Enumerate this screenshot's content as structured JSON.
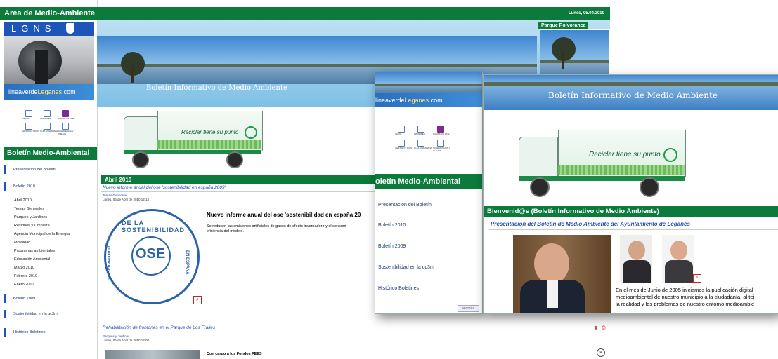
{
  "window_main": {
    "area_title": "Area de Medio-Ambiente",
    "lgns": "LGNS",
    "lineaverde": {
      "part1": "lineaverde",
      "part2": "Leganes",
      "part3": ".com"
    },
    "icons": [
      {
        "icon": "home-icon",
        "label": "INICIO"
      },
      {
        "icon": "sitemap-icon",
        "label": "MAPA WEB"
      },
      {
        "icon": "24h-icon",
        "label": "HORAS ON LINE"
      },
      {
        "icon": "gestion-icon",
        "label": "GESTION Y DIAS"
      },
      {
        "icon": "guia-icon",
        "label": "GUIA CIUDADANA"
      },
      {
        "icon": "sugerencias-icon",
        "label": "SUGERENCIAS Y QUEJAS"
      }
    ],
    "boletin_heading": "Boletín Medio-Ambiental",
    "nav": [
      {
        "label": "Presentación del Boletín",
        "type": "major"
      },
      {
        "label": "Boletín 2010",
        "type": "major"
      },
      {
        "label": "Abril 2010",
        "type": "sub"
      },
      {
        "label": "Temas Generales",
        "type": "sub"
      },
      {
        "label": "Parques y Jardines",
        "type": "sub"
      },
      {
        "label": "Residuos y Limpieza",
        "type": "sub"
      },
      {
        "label": "Agencia Municipal de la Energía",
        "type": "sub"
      },
      {
        "label": "Movilidad",
        "type": "sub"
      },
      {
        "label": "Programas ambientales",
        "type": "sub"
      },
      {
        "label": "Educación Ambiental",
        "type": "sub"
      },
      {
        "label": "Marzo 2010",
        "type": "sub"
      },
      {
        "label": "Febrero 2010",
        "type": "sub"
      },
      {
        "label": "Enero 2010",
        "type": "sub"
      },
      {
        "label": "Boletín 2009",
        "type": "major"
      },
      {
        "label": "Sostenibilidad en la uc3m",
        "type": "major"
      },
      {
        "label": "Histórico Boletines",
        "type": "major"
      }
    ],
    "date": "Lunes, 05.04.2010",
    "parque_label": "Parque Polvoranca",
    "banner_title": "Boletín Informativo de Medio Ambiente",
    "truck_slogan": "Reciclar tiene su punto",
    "section_title": "Abril 2010",
    "article1": {
      "link_title": "Nuevo informe anual del ose 'sostenibilidad en españa 2009'",
      "category": "Temas Generales",
      "date": "Lunes, 05 de Abril de 2010 12:14",
      "headline": "Nuevo informe anual del ose 'sostenibilidad en españa 20",
      "body": "Se reducen las emisiones artificiales de gases de efecto invernadero y el consum",
      "body2": "eficiencia del modelo.",
      "seal_top": "DE LA SOSTENIBILIDAD",
      "seal_left": "OBSERVATORIO",
      "seal_right": "EN ESPAÑA",
      "seal_center": "OSE"
    },
    "article2": {
      "link_title": "Rehabilitación de frontones en el Parque de Los Frailes",
      "category": "Parques y Jardines",
      "date": "Lunes, 05 de Abril de 2010 12:08",
      "headline": "Con cargo a los Fondos FEES"
    }
  },
  "window_middle": {
    "lineaverde": {
      "part1": "lineaverde",
      "part2": "Leganes",
      "part3": ".com"
    },
    "icons": [
      {
        "icon": "home-icon",
        "label": "INICIO"
      },
      {
        "icon": "sitemap-icon",
        "label": "MAPA WEB"
      },
      {
        "icon": "24h-icon",
        "label": "HORAS ON LINE"
      },
      {
        "icon": "gestion-icon",
        "label": "GESTION Y DIAS"
      },
      {
        "icon": "guia-icon",
        "label": "GUIA CIUDADANA"
      },
      {
        "icon": "sugerencias-icon",
        "label": "SUGERENCIAS Y QUEJAS"
      }
    ],
    "heading": "oletín Medio-Ambiental",
    "nav": [
      "Presentación del Boletín",
      "Boletín 2010",
      "Boletín 2009",
      "Sostenibilidad en la uc3m",
      "Histórico Boletines"
    ],
    "leer_mas": "Leer más..."
  },
  "window_right": {
    "banner_title": "Boletín Informativo de Medio Ambiente",
    "truck_slogan": "Reciclar tiene su punto",
    "section_title": "Bienvenid@s (Boletín Informativo de Medio Ambiente)",
    "link_title": "Presentación del Boletín de Medio Ambiente del Ayuntamiento de Leganés",
    "body": [
      "En el mes de Junio de 2005 iniciamos la publicación digital",
      "medioambiental de nuestro municipio a la ciudadanía, al tej",
      "la realidad y los problemas de nuestro entorno medioambie"
    ]
  },
  "colors": {
    "green": "#0b7a3a",
    "blue": "#2a4fb0",
    "lgns_blue": "#1e55b8"
  }
}
